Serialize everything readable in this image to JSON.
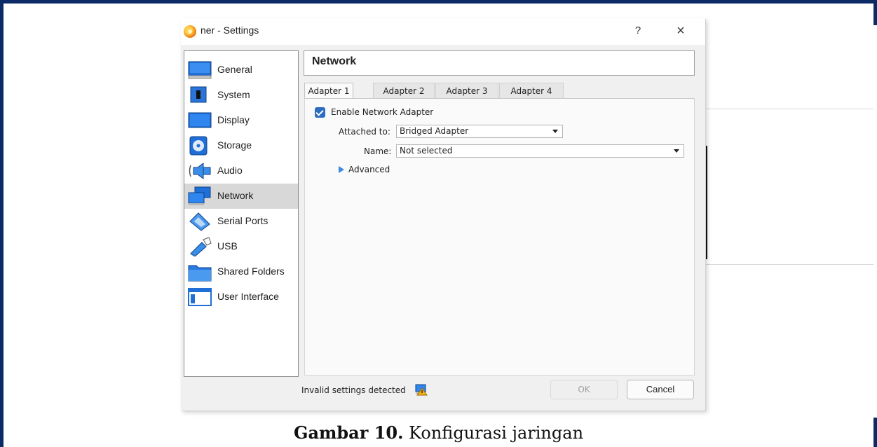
{
  "window": {
    "title": "ner - Settings",
    "help_label": "?",
    "close_label": "×"
  },
  "sidebar": {
    "items": [
      {
        "label": "General",
        "icon": "general-icon"
      },
      {
        "label": "System",
        "icon": "system-icon"
      },
      {
        "label": "Display",
        "icon": "display-icon"
      },
      {
        "label": "Storage",
        "icon": "storage-icon"
      },
      {
        "label": "Audio",
        "icon": "audio-icon"
      },
      {
        "label": "Network",
        "icon": "network-icon",
        "selected": true
      },
      {
        "label": "Serial Ports",
        "icon": "serial-ports-icon"
      },
      {
        "label": "USB",
        "icon": "usb-icon"
      },
      {
        "label": "Shared Folders",
        "icon": "shared-folders-icon"
      },
      {
        "label": "User Interface",
        "icon": "user-interface-icon"
      }
    ]
  },
  "main": {
    "section_title": "Network",
    "tabs": [
      {
        "label": "Adapter 1",
        "active": true
      },
      {
        "label": "Adapter 2"
      },
      {
        "label": "Adapter 3"
      },
      {
        "label": "Adapter 4"
      }
    ],
    "enable_adapter_label": "Enable Network Adapter",
    "enable_adapter_checked": true,
    "attached_to_label": "Attached to:",
    "attached_to_value": "Bridged Adapter",
    "name_label": "Name:",
    "name_value": "Not selected",
    "advanced_label": "Advanced"
  },
  "footer": {
    "status_text": "Invalid settings detected",
    "ok_label": "OK",
    "cancel_label": "Cancel"
  },
  "caption": {
    "bold": "Gambar 10.",
    "text": " Konfigurasi jaringan"
  },
  "colors": {
    "frame": "#0c2a66",
    "accent": "#2e6cc0",
    "selected_row": "#d8d8d8"
  }
}
